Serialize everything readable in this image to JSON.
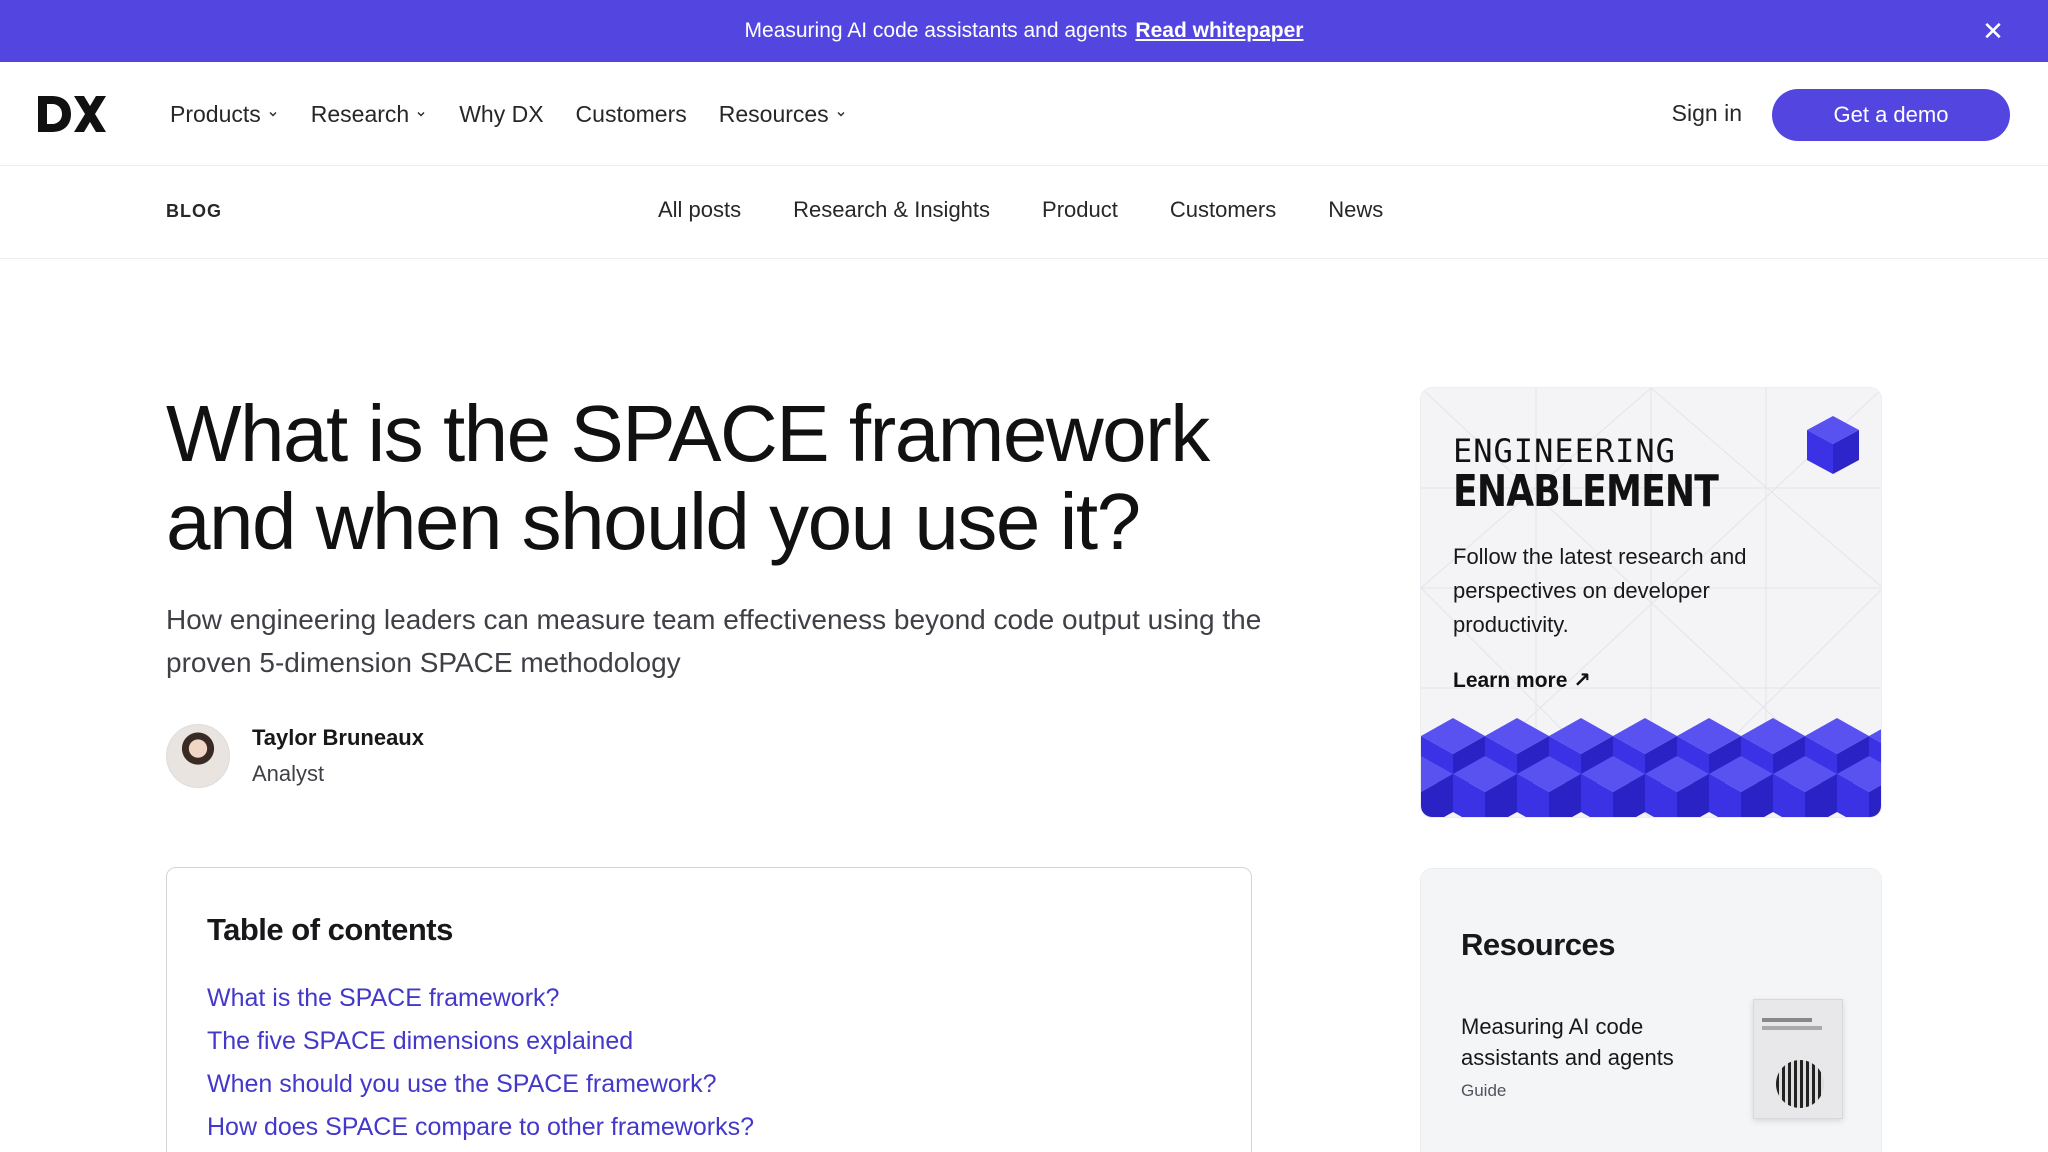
{
  "announcement": {
    "text": "Measuring AI code assistants and agents",
    "link": "Read whitepaper"
  },
  "nav": {
    "items": [
      {
        "label": "Products",
        "has_menu": true
      },
      {
        "label": "Research",
        "has_menu": true
      },
      {
        "label": "Why DX",
        "has_menu": false
      },
      {
        "label": "Customers",
        "has_menu": false
      },
      {
        "label": "Resources",
        "has_menu": true
      }
    ],
    "signin": "Sign in",
    "demo": "Get a demo"
  },
  "blog_nav": {
    "label": "BLOG",
    "categories": [
      "All posts",
      "Research & Insights",
      "Product",
      "Customers",
      "News"
    ]
  },
  "article": {
    "title_line1": "What is the SPACE framework",
    "title_line2": "and when should you use it?",
    "subtitle": "How engineering leaders can measure team effectiveness beyond code output using the proven 5-dimension SPACE methodology",
    "author": {
      "name": "Taylor Bruneaux",
      "role": "Analyst"
    }
  },
  "toc": {
    "heading": "Table of contents",
    "items": [
      "What is the SPACE framework?",
      "The five SPACE dimensions explained",
      "When should you use the SPACE framework?",
      "How does SPACE compare to other frameworks?"
    ]
  },
  "promo": {
    "eyebrow": "ENGINEERING",
    "headline": "ENABLEMENT",
    "description": "Follow the latest research and perspectives on developer productivity.",
    "cta": "Learn more ↗"
  },
  "resources": {
    "heading": "Resources",
    "item_title": "Measuring AI code assistants and agents",
    "item_type": "Guide"
  },
  "colors": {
    "brand": "#5346e0",
    "link": "#4338ca",
    "cube": "#3b32e6"
  }
}
